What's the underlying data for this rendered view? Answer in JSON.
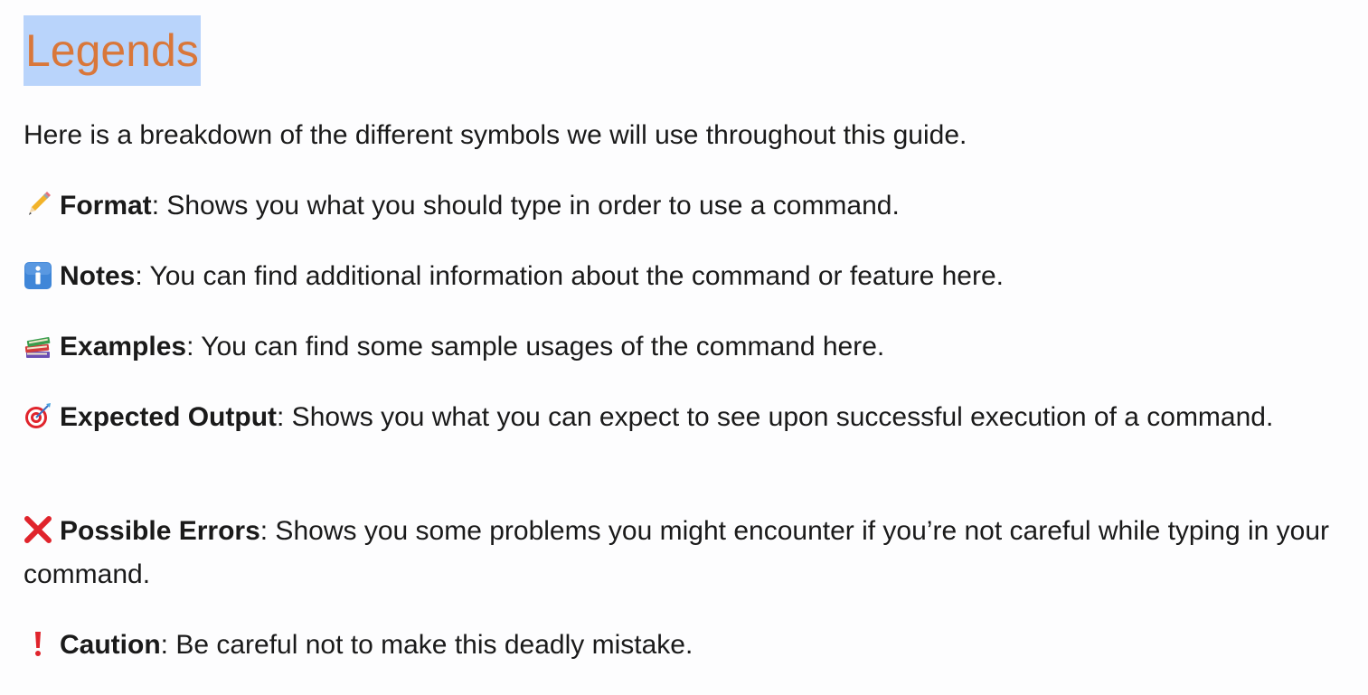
{
  "heading": "Legends",
  "intro": "Here is a breakdown of the different symbols we will use throughout this guide.",
  "legend": [
    {
      "icon": "pencil-icon",
      "term": "Format",
      "description": ": Shows you what you should type in order to use a command."
    },
    {
      "icon": "info-icon",
      "term": "Notes",
      "description": ": You can find additional information about the command or feature here."
    },
    {
      "icon": "books-icon",
      "term": "Examples",
      "description": ": You can find some sample usages of the command here."
    },
    {
      "icon": "target-icon",
      "term": "Expected Output",
      "description": ": Shows you what you can expect to see upon successful execution of a command."
    },
    {
      "icon": "cross-mark-icon",
      "term": "Possible Errors",
      "description": ": Shows you some problems you might encounter if you’re not careful while typing in your command."
    },
    {
      "icon": "exclamation-icon",
      "term": "Caution",
      "description": ": Be careful not to make this deadly mistake."
    }
  ],
  "colors": {
    "heading_text": "#d9773a",
    "heading_highlight": "#b9d4fb",
    "cross_mark": "#e0242c",
    "exclamation": "#e0242c",
    "info_blue": "#3f86d8"
  }
}
